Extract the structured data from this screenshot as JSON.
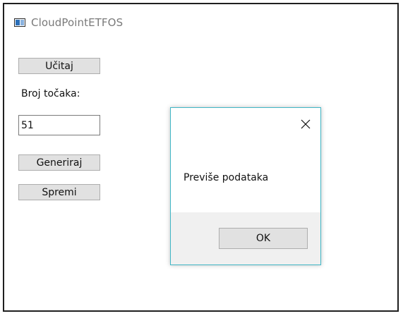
{
  "window": {
    "title": "CloudPointETFOS"
  },
  "main": {
    "load_button": "Učitaj",
    "point_count_label": "Broj točaka:",
    "point_count_value": "51",
    "generate_button": "Generiraj",
    "save_button": "Spremi"
  },
  "dialog": {
    "message": "Previše podataka",
    "ok_button": "OK",
    "close_icon": "close-icon"
  },
  "icons": {
    "app": "app-window-icon"
  },
  "colors": {
    "dialog_border": "#40b6c6",
    "button_bg": "#e1e1e1",
    "footer_bg": "#f0f0f0"
  }
}
